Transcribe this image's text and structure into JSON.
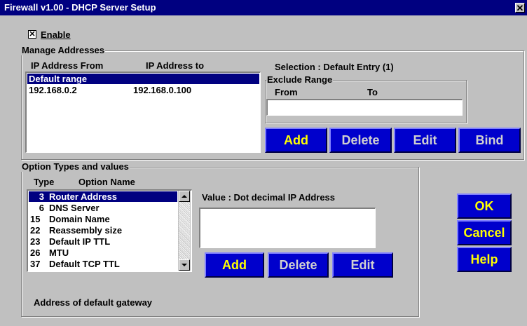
{
  "window": {
    "title": "Firewall v1.00 - DHCP Server Setup",
    "close_glyph": "✕"
  },
  "enable": {
    "checked": true,
    "check_glyph": "✕",
    "label": "Enable"
  },
  "manage": {
    "group_title": "Manage Addresses",
    "columns": {
      "from": "IP Address From",
      "to": "IP Address to"
    },
    "rows": [
      {
        "from": "Default range",
        "to": "",
        "selected": true
      },
      {
        "from": "192.168.0.2",
        "to": "192.168.0.100",
        "selected": false
      }
    ],
    "selection_text": "Selection :  Default Entry (1)",
    "exclude": {
      "title": "Exclude Range",
      "from_label": "From",
      "to_label": "To",
      "value": ""
    },
    "buttons": {
      "add": "Add",
      "delete": "Delete",
      "edit": "Edit",
      "bind": "Bind"
    }
  },
  "options": {
    "group_title": "Option Types and values",
    "columns": {
      "type": "Type",
      "name": "Option Name"
    },
    "items": [
      {
        "code": "3",
        "name": "Router Address",
        "selected": true
      },
      {
        "code": "6",
        "name": "DNS Server",
        "selected": false
      },
      {
        "code": "15",
        "name": "Domain Name",
        "selected": false
      },
      {
        "code": "22",
        "name": "Reassembly size",
        "selected": false
      },
      {
        "code": "23",
        "name": "Default IP TTL",
        "selected": false
      },
      {
        "code": "26",
        "name": "MTU",
        "selected": false
      },
      {
        "code": "37",
        "name": "Default TCP TTL",
        "selected": false
      }
    ],
    "value_label": "Value : Dot decimal IP Address",
    "value": "",
    "buttons": {
      "add": "Add",
      "delete": "Delete",
      "edit": "Edit"
    },
    "description": "Address of default gateway"
  },
  "dialog_buttons": {
    "ok": "OK",
    "cancel": "Cancel",
    "help": "Help"
  },
  "colors": {
    "titlebar": "#000080",
    "button_bg": "#0000cc",
    "button_text": "#ffff00",
    "selection": "#000080"
  }
}
